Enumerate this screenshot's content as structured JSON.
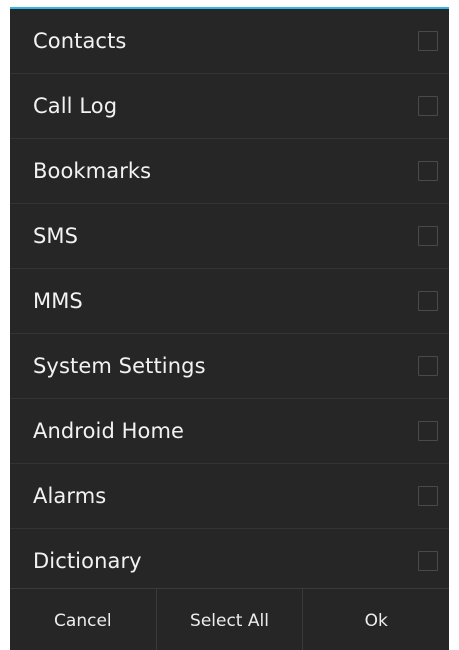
{
  "dialog": {
    "accent_color": "#33b5e5",
    "background_color": "#262626",
    "items": [
      {
        "label": "Contacts",
        "checked": false
      },
      {
        "label": "Call Log",
        "checked": false
      },
      {
        "label": "Bookmarks",
        "checked": false
      },
      {
        "label": "SMS",
        "checked": false
      },
      {
        "label": "MMS",
        "checked": false
      },
      {
        "label": "System Settings",
        "checked": false
      },
      {
        "label": "Android Home",
        "checked": false
      },
      {
        "label": "Alarms",
        "checked": false
      },
      {
        "label": "Dictionary",
        "checked": false
      }
    ],
    "buttons": {
      "cancel": "Cancel",
      "select_all": "Select All",
      "ok": "Ok"
    }
  }
}
